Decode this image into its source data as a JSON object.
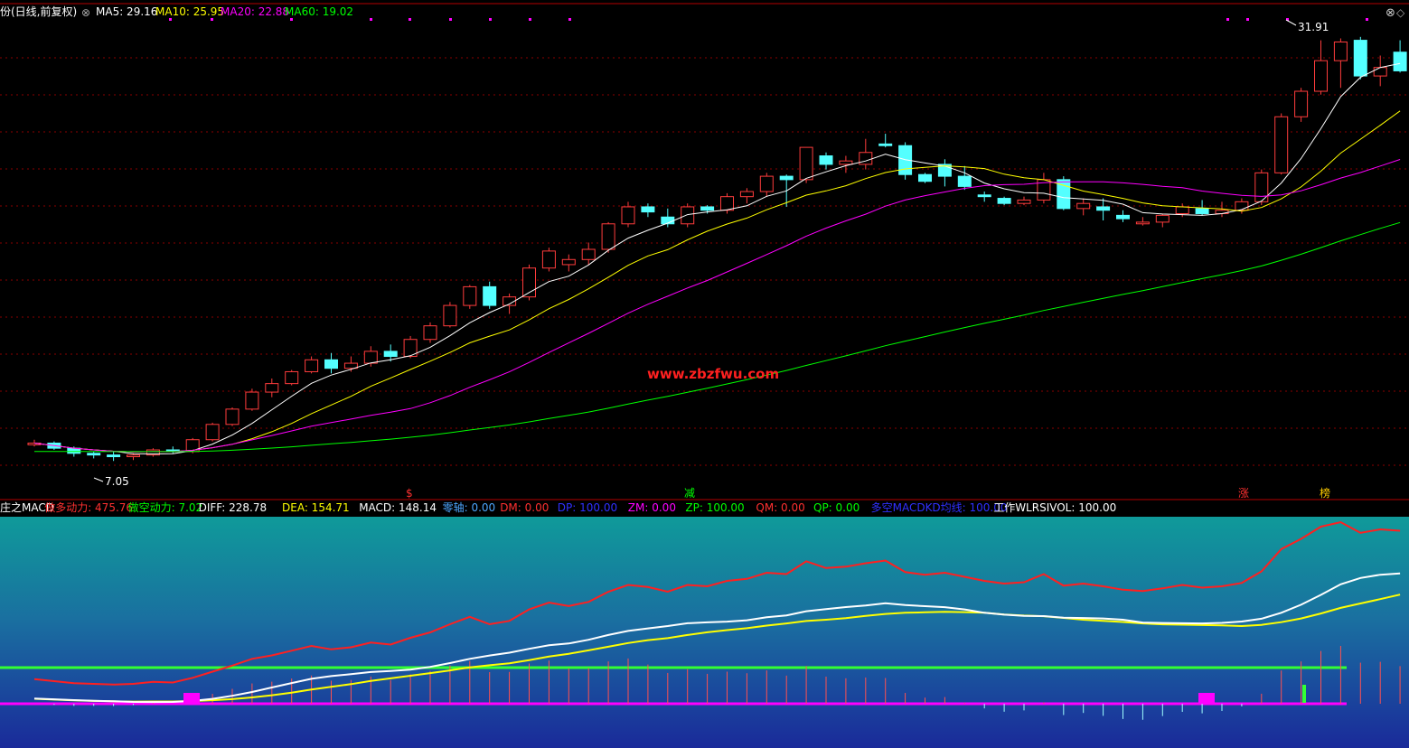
{
  "header": {
    "title": "份(日线,前复权)",
    "ma": [
      {
        "label": "MA5: 29.16",
        "color": "#ffffff"
      },
      {
        "label": "MA10: 25.95",
        "color": "#ffff00"
      },
      {
        "label": "MA20: 22.88",
        "color": "#ff00ff"
      },
      {
        "label": "MA60: 19.02",
        "color": "#00ff00"
      }
    ]
  },
  "price_annotations": {
    "high": "31.91",
    "low": "7.05"
  },
  "watermark": "www.zbzfwu.com",
  "signal_marks": [
    {
      "text": "$",
      "color": "#ff3030"
    },
    {
      "text": "减",
      "color": "#00ff00"
    },
    {
      "text": "涨",
      "color": "#ff3030"
    },
    {
      "text": "榜",
      "color": "#ffcc00"
    }
  ],
  "indicator_header": [
    {
      "text": "庄之MACD",
      "color": "#ffffff"
    },
    {
      "text": "做多动力: 475.76",
      "color": "#ff3030"
    },
    {
      "text": "做空动力: 7.02",
      "color": "#00ff00"
    },
    {
      "text": "DIFF: 228.78",
      "color": "#ffffff"
    },
    {
      "text": "DEA: 154.71",
      "color": "#ffff00"
    },
    {
      "text": "MACD: 148.14",
      "color": "#ffffff"
    },
    {
      "text": "零轴: 0.00",
      "color": "#4da6ff"
    },
    {
      "text": "DM: 0.00",
      "color": "#ff3030"
    },
    {
      "text": "DP: 100.00",
      "color": "#3030ff"
    },
    {
      "text": "ZM: 0.00",
      "color": "#ff00ff"
    },
    {
      "text": "ZP: 100.00",
      "color": "#00ff00"
    },
    {
      "text": "QM: 0.00",
      "color": "#ff3030"
    },
    {
      "text": "QP: 0.00",
      "color": "#00ff00"
    },
    {
      "text": "多空MACDKD均线: 100.00",
      "color": "#3030ff"
    },
    {
      "text": "工作WLRSIVOL: 100.00",
      "color": "#ffffff"
    }
  ],
  "colors": {
    "up": "#ff3c3c",
    "down": "#54ffff",
    "ma5": "#ffffff",
    "ma10": "#ffff00",
    "ma20": "#ff00ff",
    "ma60": "#00ff00"
  },
  "chart_data": {
    "type": "candlestick",
    "ylim": [
      6.0,
      33.0
    ],
    "candles": [
      [
        8.0,
        8.3,
        7.9,
        8.1
      ],
      [
        8.1,
        8.2,
        7.7,
        7.8
      ],
      [
        7.8,
        7.9,
        7.3,
        7.5
      ],
      [
        7.5,
        7.6,
        7.2,
        7.4
      ],
      [
        7.4,
        7.6,
        7.05,
        7.3
      ],
      [
        7.3,
        7.5,
        7.1,
        7.4
      ],
      [
        7.4,
        7.8,
        7.3,
        7.7
      ],
      [
        7.7,
        7.9,
        7.5,
        7.6
      ],
      [
        7.6,
        8.4,
        7.5,
        8.3
      ],
      [
        8.3,
        9.3,
        8.2,
        9.2
      ],
      [
        9.2,
        10.2,
        9.1,
        10.1
      ],
      [
        10.1,
        11.3,
        10.0,
        11.1
      ],
      [
        11.1,
        11.9,
        10.8,
        11.6
      ],
      [
        11.6,
        12.4,
        11.5,
        12.3
      ],
      [
        12.3,
        13.2,
        12.2,
        13.0
      ],
      [
        13.0,
        13.4,
        12.2,
        12.5
      ],
      [
        12.5,
        13.2,
        12.3,
        12.8
      ],
      [
        12.8,
        13.8,
        12.6,
        13.5
      ],
      [
        13.5,
        13.9,
        12.9,
        13.2
      ],
      [
        13.2,
        14.4,
        13.1,
        14.2
      ],
      [
        14.2,
        15.2,
        14.0,
        15.0
      ],
      [
        15.0,
        16.4,
        14.9,
        16.2
      ],
      [
        16.2,
        17.4,
        16.0,
        17.3
      ],
      [
        17.3,
        17.6,
        16.0,
        16.2
      ],
      [
        16.2,
        16.9,
        15.7,
        16.7
      ],
      [
        16.7,
        18.6,
        16.5,
        18.4
      ],
      [
        18.4,
        19.6,
        18.2,
        19.4
      ],
      [
        18.6,
        19.2,
        18.2,
        18.9
      ],
      [
        18.9,
        19.9,
        18.6,
        19.5
      ],
      [
        19.5,
        21.1,
        19.3,
        21.0
      ],
      [
        21.0,
        22.3,
        20.8,
        22.0
      ],
      [
        22.0,
        22.2,
        21.4,
        21.7
      ],
      [
        21.4,
        21.9,
        20.8,
        21.0
      ],
      [
        21.0,
        22.2,
        20.8,
        22.0
      ],
      [
        22.0,
        22.1,
        21.6,
        21.8
      ],
      [
        21.8,
        22.8,
        21.6,
        22.6
      ],
      [
        22.6,
        23.1,
        22.2,
        22.9
      ],
      [
        22.9,
        24.0,
        22.6,
        23.8
      ],
      [
        23.8,
        23.9,
        22.0,
        23.6
      ],
      [
        23.6,
        25.5,
        23.4,
        25.5
      ],
      [
        25.0,
        25.2,
        24.2,
        24.5
      ],
      [
        24.5,
        25.0,
        24.0,
        24.7
      ],
      [
        24.5,
        26.0,
        24.2,
        25.2
      ],
      [
        25.7,
        26.3,
        25.5,
        25.6
      ],
      [
        25.6,
        25.8,
        23.6,
        23.9
      ],
      [
        23.9,
        24.0,
        23.4,
        23.5
      ],
      [
        24.5,
        24.8,
        23.2,
        23.8
      ],
      [
        23.8,
        24.4,
        23.0,
        23.2
      ],
      [
        22.7,
        22.9,
        22.3,
        22.6
      ],
      [
        22.5,
        22.6,
        22.1,
        22.2
      ],
      [
        22.2,
        22.6,
        22.1,
        22.4
      ],
      [
        22.4,
        24.0,
        22.2,
        23.6
      ],
      [
        23.6,
        23.8,
        21.8,
        21.9
      ],
      [
        21.9,
        22.5,
        21.5,
        22.2
      ],
      [
        22.0,
        22.5,
        21.2,
        21.8
      ],
      [
        21.5,
        21.8,
        21.1,
        21.3
      ],
      [
        21.0,
        21.4,
        20.9,
        21.1
      ],
      [
        21.1,
        21.6,
        20.8,
        21.5
      ],
      [
        21.6,
        22.2,
        21.4,
        22.0
      ],
      [
        21.9,
        22.4,
        21.5,
        21.6
      ],
      [
        21.6,
        22.3,
        21.4,
        21.8
      ],
      [
        21.8,
        22.5,
        21.6,
        22.3
      ],
      [
        22.3,
        24.2,
        22.1,
        24.0
      ],
      [
        24.0,
        27.5,
        23.9,
        27.3
      ],
      [
        27.3,
        29.0,
        27.0,
        28.8
      ],
      [
        28.8,
        31.8,
        28.6,
        30.6
      ],
      [
        30.6,
        31.91,
        29.0,
        31.7
      ],
      [
        31.8,
        32.0,
        29.5,
        29.7
      ],
      [
        29.7,
        30.9,
        29.1,
        30.2
      ],
      [
        31.1,
        31.8,
        29.9,
        30.0
      ]
    ]
  }
}
